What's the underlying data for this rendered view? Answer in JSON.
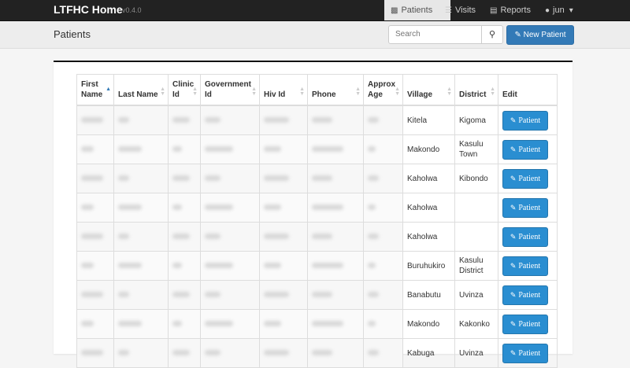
{
  "navbar": {
    "brand": "LTFHC Home",
    "version": "v0.4.0",
    "items": [
      {
        "label": "Patients",
        "icon": "users-icon",
        "active": true
      },
      {
        "label": "Visits",
        "icon": "list-icon",
        "active": false
      },
      {
        "label": "Reports",
        "icon": "folder-icon",
        "active": false
      },
      {
        "label": "jun",
        "icon": "user-icon",
        "active": false
      }
    ]
  },
  "header": {
    "title": "Patients",
    "search_placeholder": "Search",
    "new_button": "New Patient"
  },
  "table": {
    "columns": [
      "First Name",
      "Last Name",
      "Clinic Id",
      "Government Id",
      "Hiv Id",
      "Phone",
      "Approx Age",
      "Village",
      "District",
      "Edit"
    ],
    "edit_label": "Patient",
    "rows": [
      {
        "village": "Kitela",
        "district": "Kigoma"
      },
      {
        "village": "Makondo",
        "district": "Kasulu Town"
      },
      {
        "village": "Kaholwa",
        "district": "Kibondo"
      },
      {
        "village": "Kaholwa",
        "district": ""
      },
      {
        "village": "Kaholwa",
        "district": ""
      },
      {
        "village": "Buruhukiro",
        "district": "Kasulu District"
      },
      {
        "village": "Banabutu",
        "district": "Uvinza"
      },
      {
        "village": "Makondo",
        "district": "Kakonko"
      },
      {
        "village": "Kabuga",
        "district": "Uvinza"
      }
    ]
  }
}
